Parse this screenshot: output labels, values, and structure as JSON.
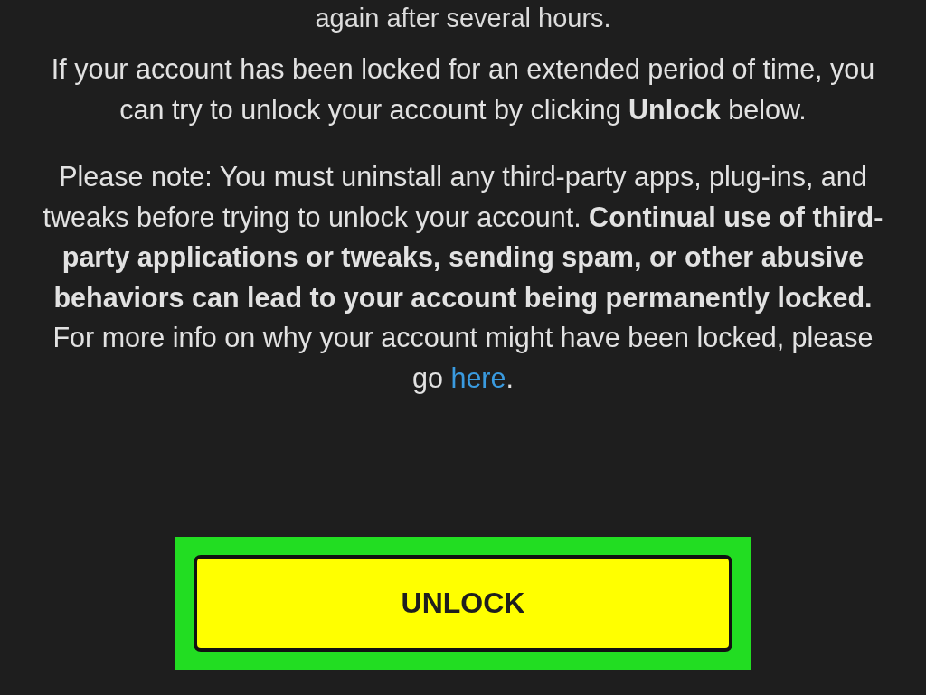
{
  "top_text": "again after several hours.",
  "paragraphs": [
    {
      "text": "If your account has been locked for an extended period of time, you can try to unlock your account by clicking **Unlock** below."
    },
    {
      "text": "Please note: You must uninstall any third-party apps, plug-ins, and tweaks before trying to unlock your account. **Continual use of third-party applications or tweaks, sending spam, or other abusive behaviors can lead to your account being permanently locked.** For more info on why your account might have been locked, please go ",
      "link": "here",
      "after": "."
    }
  ],
  "unlock_button": {
    "label": "UNLOCK",
    "highlighted": true
  }
}
